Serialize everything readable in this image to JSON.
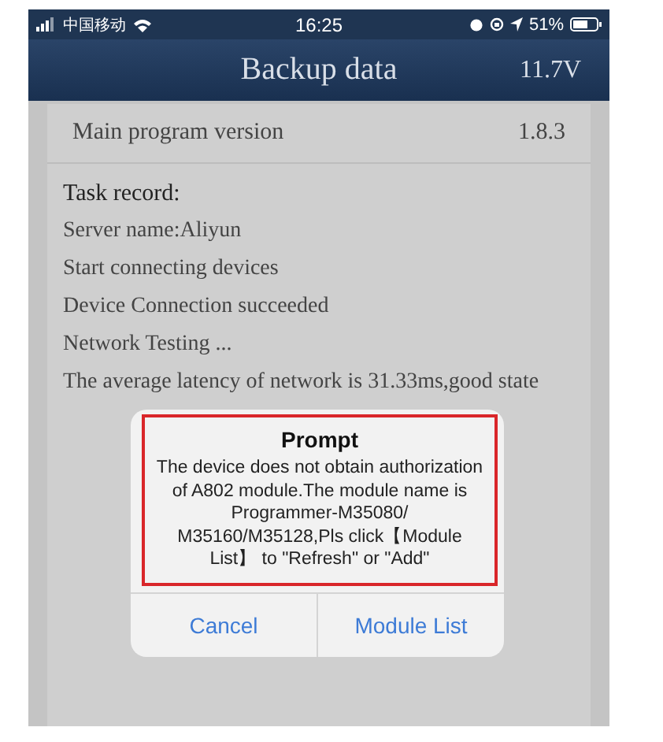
{
  "status_bar": {
    "carrier": "中国移动",
    "time": "16:25",
    "battery": "51%"
  },
  "nav_bar": {
    "title": "Backup data",
    "voltage": "11.7V"
  },
  "version_row": {
    "label": "Main program version",
    "value": "1.8.3"
  },
  "task_record": {
    "heading": "Task record:",
    "lines": [
      "Server name:Aliyun",
      "Start connecting devices",
      "Device Connection succeeded",
      "Network Testing ...",
      "The average latency of network is 31.33ms,good state"
    ]
  },
  "dialog": {
    "title": "Prompt",
    "message": "The device does not obtain authorization of A802 module.The module name is Programmer-M35080/ M35160/M35128,Pls click【Module List】 to \"Refresh\" or \"Add\"",
    "buttons": [
      "Cancel",
      "Module List"
    ]
  }
}
